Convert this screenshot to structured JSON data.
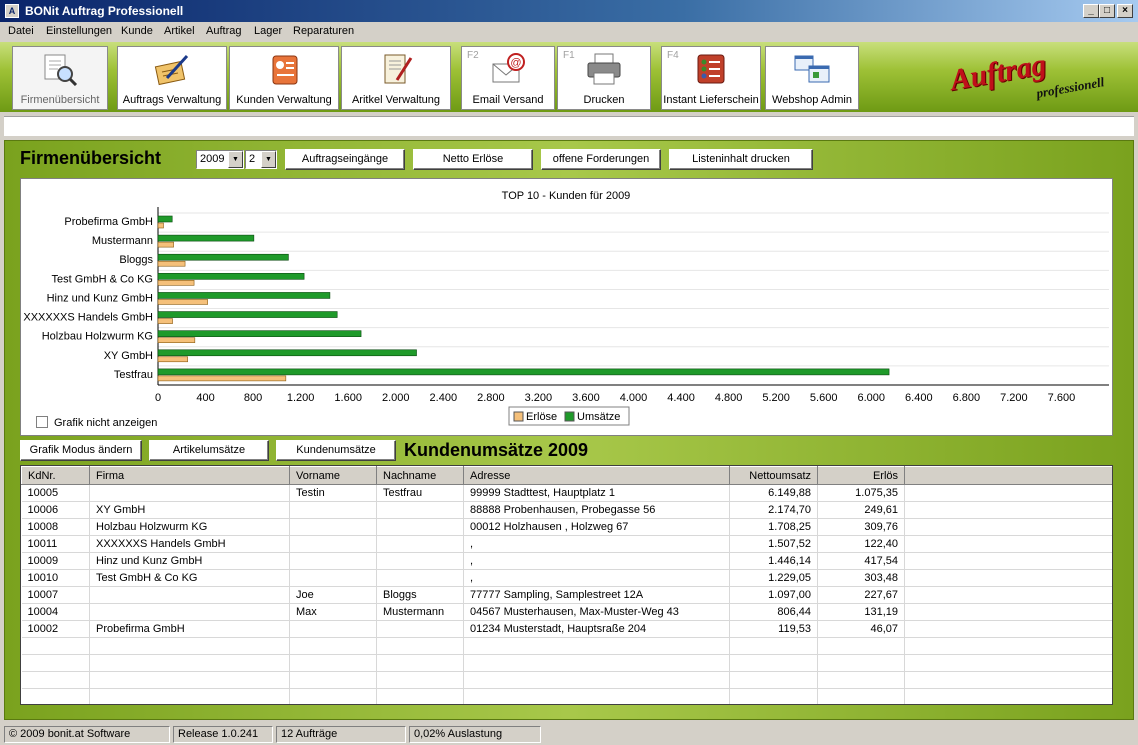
{
  "window": {
    "title": "BONit Auftrag Professionell",
    "icon": "app-icon"
  },
  "menu": [
    "Datei",
    "Einstellungen",
    "Kunde",
    "Artikel",
    "Auftrag",
    "Lager",
    "Reparaturen"
  ],
  "toolbar": [
    {
      "label": "Firmenübersicht",
      "fkey": "",
      "icon": "magnifier-document-icon",
      "active": true
    },
    {
      "label": "Auftrags Verwaltung",
      "fkey": "",
      "icon": "clipboard-pen-icon"
    },
    {
      "label": "Kunden Verwaltung",
      "fkey": "",
      "icon": "customer-card-icon"
    },
    {
      "label": "Aritkel Verwaltung",
      "fkey": "",
      "icon": "notebook-pen-icon"
    },
    {
      "label": "Email Versand",
      "fkey": "F2",
      "icon": "email-icon"
    },
    {
      "label": "Drucken",
      "fkey": "F1",
      "icon": "printer-icon"
    },
    {
      "label": "Instant Lieferschein",
      "fkey": "F4",
      "icon": "checklist-icon"
    },
    {
      "label": "Webshop Admin",
      "fkey": "",
      "icon": "webshop-windows-icon"
    }
  ],
  "logo": {
    "main": "Auftrag",
    "sub": "professionell"
  },
  "overview": {
    "title": "Firmenübersicht",
    "year": "2009",
    "period": "2",
    "buttons": [
      "Auftragseingänge",
      "Netto Erlöse",
      "offene Forderungen",
      "Listeninhalt drucken"
    ]
  },
  "chart_data": {
    "type": "bar",
    "orientation": "horizontal",
    "title": "TOP 10 - Kunden für 2009",
    "categories": [
      "Probefirma GmbH",
      "Mustermann",
      "Bloggs",
      "Test GmbH & Co KG",
      "Hinz und Kunz GmbH",
      "XXXXXXS Handels GmbH",
      "Holzbau Holzwurm KG",
      "XY GmbH",
      "Testfrau"
    ],
    "series": [
      {
        "name": "Erlöse",
        "color": "#f5c07a",
        "values": [
          46.07,
          131.19,
          227.67,
          303.48,
          417.54,
          122.4,
          309.76,
          249.61,
          1075.35
        ]
      },
      {
        "name": "Umsätze",
        "color": "#1f9a2a",
        "values": [
          119.53,
          806.44,
          1097.0,
          1229.05,
          1446.14,
          1507.52,
          1708.25,
          2174.7,
          6149.88
        ]
      }
    ],
    "xlim": [
      0,
      8000
    ],
    "xticks": [
      "0",
      "400",
      "800",
      "1.200",
      "1.600",
      "2.000",
      "2.400",
      "2.800",
      "3.200",
      "3.600",
      "4.000",
      "4.400",
      "4.800",
      "5.200",
      "5.600",
      "6.000",
      "6.400",
      "6.800",
      "7.200",
      "7.600"
    ],
    "grid": true,
    "legend": "bottom-center"
  },
  "hide_graph_label": "Grafik nicht anzeigen",
  "lower_buttons": [
    "Grafik Modus ändern",
    "Artikelumsätze",
    "Kundenumsätze"
  ],
  "table": {
    "title": "Kundenumsätze 2009",
    "columns": [
      "KdNr.",
      "Firma",
      "Vorname",
      "Nachname",
      "Adresse",
      "Nettoumsatz",
      "Erlös"
    ],
    "rows": [
      [
        "10005",
        "",
        "Testin",
        "Testfrau",
        "99999 Stadttest, Hauptplatz 1",
        "6.149,88",
        "1.075,35"
      ],
      [
        "10006",
        "XY GmbH",
        "",
        "",
        "88888 Probenhausen, Probegasse 56",
        "2.174,70",
        "249,61"
      ],
      [
        "10008",
        "Holzbau Holzwurm KG",
        "",
        "",
        "00012 Holzhausen , Holzweg 67",
        "1.708,25",
        "309,76"
      ],
      [
        "10011",
        "XXXXXXS Handels GmbH",
        "",
        "",
        " ,",
        "1.507,52",
        "122,40"
      ],
      [
        "10009",
        "Hinz und Kunz GmbH",
        "",
        "",
        " ,",
        "1.446,14",
        "417,54"
      ],
      [
        "10010",
        "Test GmbH & Co KG",
        "",
        "",
        " ,",
        "1.229,05",
        "303,48"
      ],
      [
        "10007",
        "",
        "Joe",
        "Bloggs",
        "77777 Sampling, Samplestreet 12A",
        "1.097,00",
        "227,67"
      ],
      [
        "10004",
        "",
        "Max",
        "Mustermann",
        "04567 Musterhausen, Max-Muster-Weg 43",
        "806,44",
        "131,19"
      ],
      [
        "10002",
        "Probefirma GmbH",
        "",
        "",
        "01234 Musterstadt, Hauptsraße 204",
        "119,53",
        "46,07"
      ]
    ]
  },
  "status": [
    "© 2009 bonit.at Software",
    "Release 1.0.241",
    "12 Aufträge",
    "0,02% Auslastung"
  ]
}
